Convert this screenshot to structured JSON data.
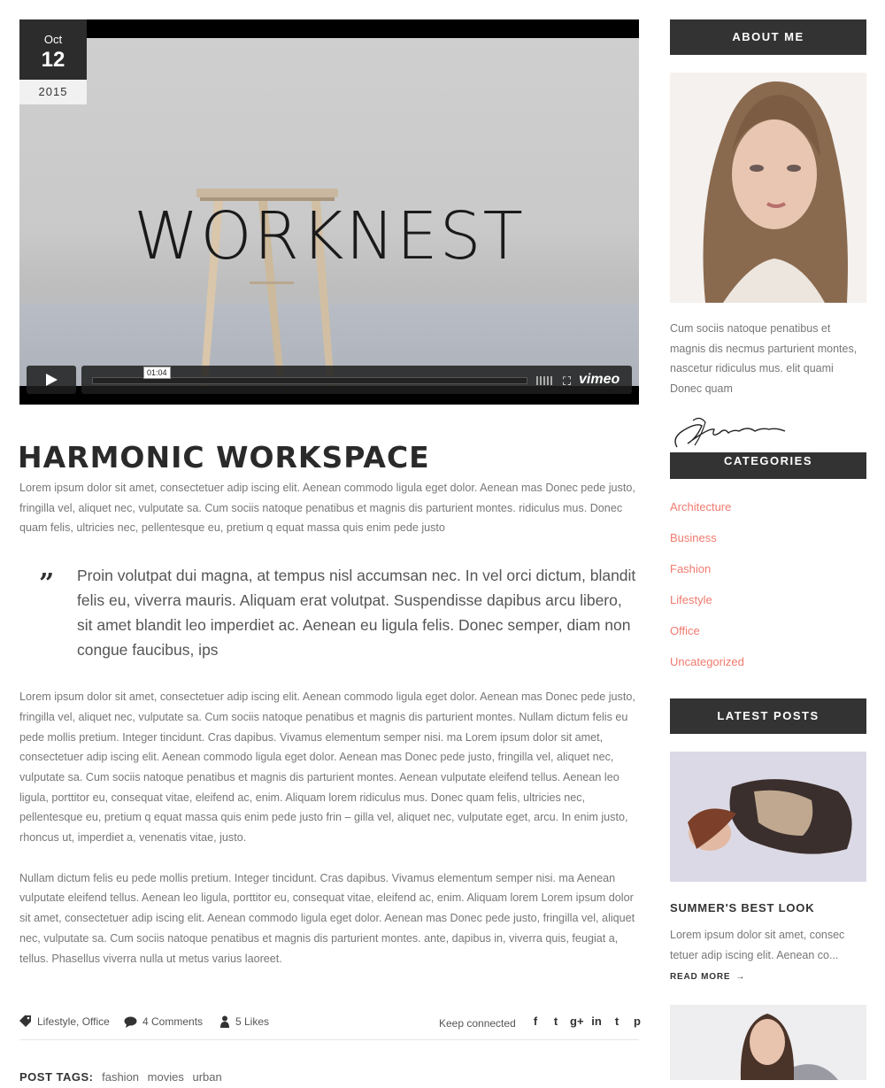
{
  "post": {
    "date": {
      "month": "Oct",
      "day": "12",
      "year": "2015"
    },
    "video": {
      "overlay_title": "WORKNEST",
      "time": "01:04",
      "provider": "vimeo"
    },
    "title": "HARMONIC WORKSPACE",
    "intro": "Lorem ipsum dolor sit amet, consectetuer adip iscing elit. Aenean commodo ligula eget dolor. Aenean mas Donec pede justo, fringilla vel, aliquet nec, vulputate sa. Cum sociis natoque penatibus et magnis dis parturient montes. ridiculus mus. Donec quam felis, ultricies nec, pellentesque eu, pretium q equat massa quis enim pede justo",
    "quote": "Proin volutpat dui magna, at tempus nisl accumsan nec. In vel orci dictum, blandit felis eu, viverra mauris. Aliquam erat volutpat. Suspendisse dapibus arcu libero, sit amet blandit leo imperdiet ac. Aenean eu ligula felis. Donec semper, diam non congue faucibus, ips",
    "body_1": "Lorem ipsum dolor sit amet, consectetuer adip iscing elit. Aenean commodo ligula eget dolor. Aenean mas Donec pede justo, fringilla vel, aliquet nec, vulputate sa. Cum sociis natoque penatibus et magnis dis parturient montes. Nullam dictum felis eu pede mollis pretium. Integer tincidunt. Cras dapibus. Vivamus elementum semper nisi. ma Lorem ipsum dolor sit amet, consectetuer adip iscing elit. Aenean commodo ligula eget dolor. Aenean mas Donec pede justo, fringilla vel, aliquet nec, vulputate sa. Cum sociis natoque penatibus et magnis dis parturient montes. Aenean vulputate eleifend tellus. Aenean leo ligula, porttitor eu, consequat vitae, eleifend ac, enim. Aliquam lorem ridiculus mus. Donec quam felis, ultricies nec, pellentesque eu, pretium q equat massa quis enim pede justo frin – gilla vel, aliquet nec, vulputate eget, arcu. In enim justo, rhoncus ut, imperdiet a, venenatis vitae, justo.",
    "body_2": "Nullam dictum felis eu pede mollis pretium. Integer tincidunt. Cras dapibus. Vivamus elementum semper nisi. ma Aenean vulputate eleifend tellus. Aenean leo ligula, porttitor eu, consequat vitae, eleifend ac, enim. Aliquam lorem Lorem ipsum dolor sit amet, consectetuer adip iscing elit. Aenean commodo ligula eget dolor. Aenean mas Donec pede justo, fringilla vel, aliquet nec, vulputate sa. Cum sociis natoque penatibus et magnis dis parturient montes. ante, dapibus in, viverra quis, feugiat a, tellus. Phasellus viverra nulla ut metus varius laoreet.",
    "meta": {
      "categories": "Lifestyle, Office",
      "comments": "4 Comments",
      "likes": "5 Likes",
      "keep_connected": "Keep connected"
    },
    "social": [
      "f",
      "t",
      "g+",
      "in",
      "t",
      "p"
    ],
    "tags_label": "POST TAGS:",
    "tags": [
      "fashion",
      "movies",
      "urban"
    ]
  },
  "sidebar": {
    "about": {
      "title": "ABOUT ME",
      "text": "Cum sociis natoque penatibus et magnis dis necmus parturient montes, nascetur ridiculus mus. elit quami Donec quam"
    },
    "categories": {
      "title": "CATEGORIES",
      "items": [
        "Architecture",
        "Business",
        "Fashion",
        "Lifestyle",
        "Office",
        "Uncategorized"
      ]
    },
    "latest": {
      "title": "LATEST POSTS",
      "post_title": "SUMMER'S BEST LOOK",
      "excerpt": "Lorem ipsum dolor sit amet, consec tetuer adip iscing elit. Aenean co...",
      "read_more": "READ MORE"
    }
  },
  "colors": {
    "accent": "#f07a6e",
    "dark": "#333333"
  }
}
